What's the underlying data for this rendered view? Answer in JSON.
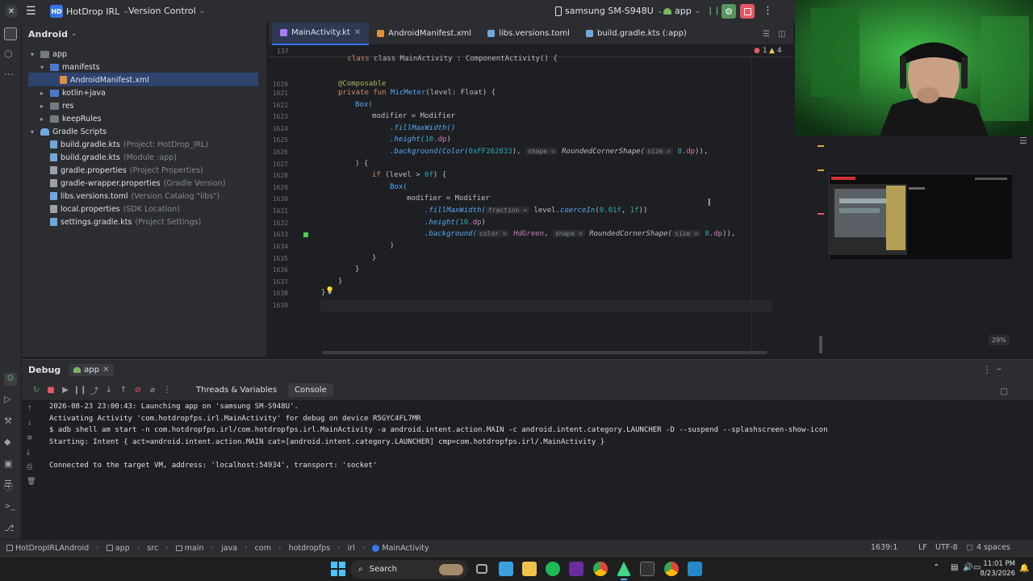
{
  "titlebar": {
    "project_badge": "HD",
    "project_name": "HotDrop IRL",
    "vcs": "Version Control",
    "device": "samsung SM-S948U",
    "run_config": "app"
  },
  "project_panel": {
    "view_mode": "Android",
    "tree": [
      {
        "label": "app",
        "hint": ""
      },
      {
        "label": "manifests",
        "hint": ""
      },
      {
        "label": "AndroidManifest.xml",
        "hint": ""
      },
      {
        "label": "kotlin+java",
        "hint": ""
      },
      {
        "label": "res",
        "hint": ""
      },
      {
        "label": "keepRules",
        "hint": ""
      },
      {
        "label": "Gradle Scripts",
        "hint": ""
      },
      {
        "label": "build.gradle.kts",
        "hint": "(Project: HotDrop_IRL)"
      },
      {
        "label": "build.gradle.kts",
        "hint": "(Module :app)"
      },
      {
        "label": "gradle.properties",
        "hint": "(Project Properties)"
      },
      {
        "label": "gradle-wrapper.properties",
        "hint": "(Gradle Version)"
      },
      {
        "label": "libs.versions.toml",
        "hint": "(Version Catalog \"libs\")"
      },
      {
        "label": "local.properties",
        "hint": "(SDK Location)"
      },
      {
        "label": "settings.gradle.kts",
        "hint": "(Project Settings)"
      }
    ]
  },
  "editor": {
    "tabs": [
      "MainActivity.kt",
      "AndroidManifest.xml",
      "libs.versions.toml",
      "build.gradle.kts (:app)"
    ],
    "sticky_line_num": "137",
    "sticky_line": "class MainActivity : ComponentActivity() {",
    "errors": "1",
    "warnings": "4",
    "line_numbers": [
      "1620",
      "1621",
      "1622",
      "1623",
      "1624",
      "1625",
      "1626",
      "1627",
      "1628",
      "1629",
      "1630",
      "1631",
      "1632",
      "1633",
      "1634",
      "1635",
      "1636",
      "1637",
      "1638",
      "1639"
    ],
    "code": {
      "l1620": "@Composable",
      "l1621_kw": "private fun ",
      "l1621_fn": "MicMeter",
      "l1621_rest": "(level: Float) {",
      "l1622": "Box(",
      "l1623": "modifier = Modifier",
      "l1624": ".fillMaxWidth()",
      "l1625_a": ".height(",
      "l1625_b": "10",
      "l1625_c": ".dp",
      "l1625_d": ")",
      "l1626_a": ".background(Color(",
      "l1626_b": "0xFF262833",
      "l1626_c": "), ",
      "l1626_hint1": "shape =",
      "l1626_d": " RoundedCornerShape(",
      "l1626_hint2": "size =",
      "l1626_e": " 8",
      "l1626_f": ".dp",
      "l1626_g": ")),",
      "l1627": ") {",
      "l1628_a": "if",
      "l1628_b": " (level > ",
      "l1628_c": "0f",
      "l1628_d": ") {",
      "l1629": "Box(",
      "l1630": "modifier = Modifier",
      "l1631_a": ".fillMaxWidth(",
      "l1631_hint": "fraction =",
      "l1631_b": " level.",
      "l1631_c": "coerceIn",
      "l1631_d": "(",
      "l1631_e": "0.01f",
      "l1631_f": ", ",
      "l1631_g": "1f",
      "l1631_h": "))",
      "l1632_a": ".height(",
      "l1632_b": "10",
      "l1632_c": ".dp",
      "l1632_d": ")",
      "l1633_a": ".background(",
      "l1633_hint1": "color =",
      "l1633_b": " HdGreen",
      "l1633_c": ", ",
      "l1633_hint2": "shape =",
      "l1633_d": " RoundedCornerShape(",
      "l1633_hint3": "size =",
      "l1633_e": " 8",
      "l1633_f": ".dp",
      "l1633_g": ")),",
      "l1634": ")",
      "l1635": "}",
      "l1636": "}",
      "l1637": "}",
      "l1638": "}",
      "l1639": ""
    }
  },
  "right_panel": {
    "zoom": "29%"
  },
  "debug": {
    "title": "Debug",
    "session_tab": "app",
    "subtabs": [
      "Threads & Variables",
      "Console"
    ],
    "console": [
      "2026-08-23 23:00:43: Launching app on 'samsung SM-S948U'.",
      "Activating Activity 'com.hotdropfps.irl.MainActivity' for debug on device R5GYC4FL7MR",
      "$ adb shell am start -n com.hotdropfps.irl/com.hotdropfps.irl.MainActivity -a android.intent.action.MAIN -c android.intent.category.LAUNCHER -D --suspend --splashscreen-show-icon",
      "Starting: Intent { act=android.intent.action.MAIN cat=[android.intent.category.LAUNCHER] cmp=com.hotdropfps.irl/.MainActivity }",
      "",
      "Connected to the target VM, address: 'localhost:54934', transport: 'socket'"
    ]
  },
  "statusbar": {
    "breadcrumb": [
      "HotDropIRLAndroid",
      "app",
      "src",
      "main",
      "java",
      "com",
      "hotdropfps",
      "irl",
      "MainActivity"
    ],
    "position": "1639:1",
    "line_sep": "LF",
    "encoding": "UTF-8",
    "indent": "4 spaces"
  },
  "taskbar": {
    "search_label": "Search",
    "time": "11:01 PM",
    "date": "8/23/2026"
  },
  "colors": {
    "accent": "#3574f0",
    "debug_green": "#57965c",
    "stop_red": "#e55765"
  }
}
